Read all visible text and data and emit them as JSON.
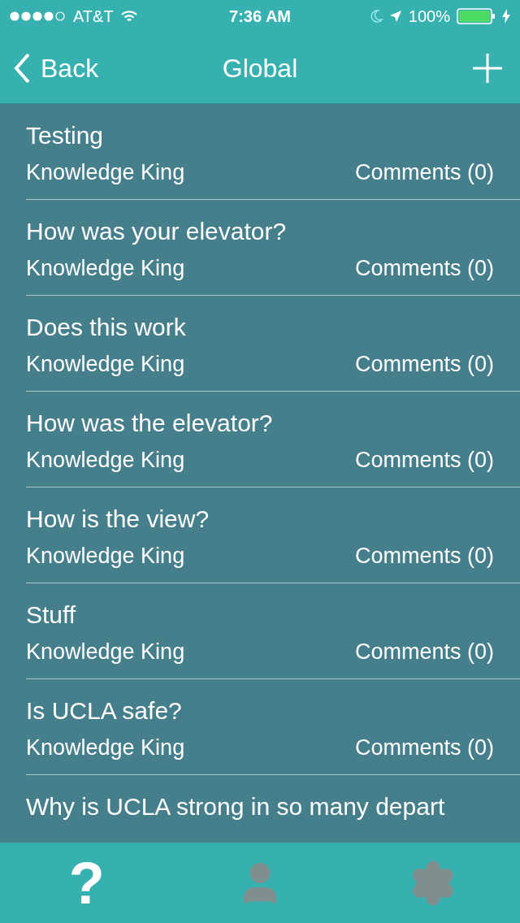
{
  "status_bar": {
    "carrier": "AT&T",
    "time": "7:36 AM",
    "battery": "100%"
  },
  "nav_bar": {
    "back": "Back",
    "title": "Global"
  },
  "posts": [
    {
      "title": "Testing",
      "author": "Knowledge King",
      "comments": "Comments (0)"
    },
    {
      "title": "How was your elevator?",
      "author": "Knowledge King",
      "comments": "Comments (0)"
    },
    {
      "title": "Does this work",
      "author": "Knowledge King",
      "comments": "Comments (0)"
    },
    {
      "title": "How was the elevator?",
      "author": "Knowledge King",
      "comments": "Comments (0)"
    },
    {
      "title": "How is the view?",
      "author": "Knowledge King",
      "comments": "Comments (0)"
    },
    {
      "title": "Stuff",
      "author": "Knowledge King",
      "comments": "Comments (0)"
    },
    {
      "title": "Is UCLA safe?",
      "author": "Knowledge King",
      "comments": "Comments (0)"
    },
    {
      "title": "Why is UCLA strong in so many depart"
    }
  ],
  "tab_bar": [
    {
      "kind": "questions",
      "label": "?",
      "selected": true
    },
    {
      "kind": "profile",
      "selected": false
    },
    {
      "kind": "settings",
      "selected": false
    }
  ]
}
